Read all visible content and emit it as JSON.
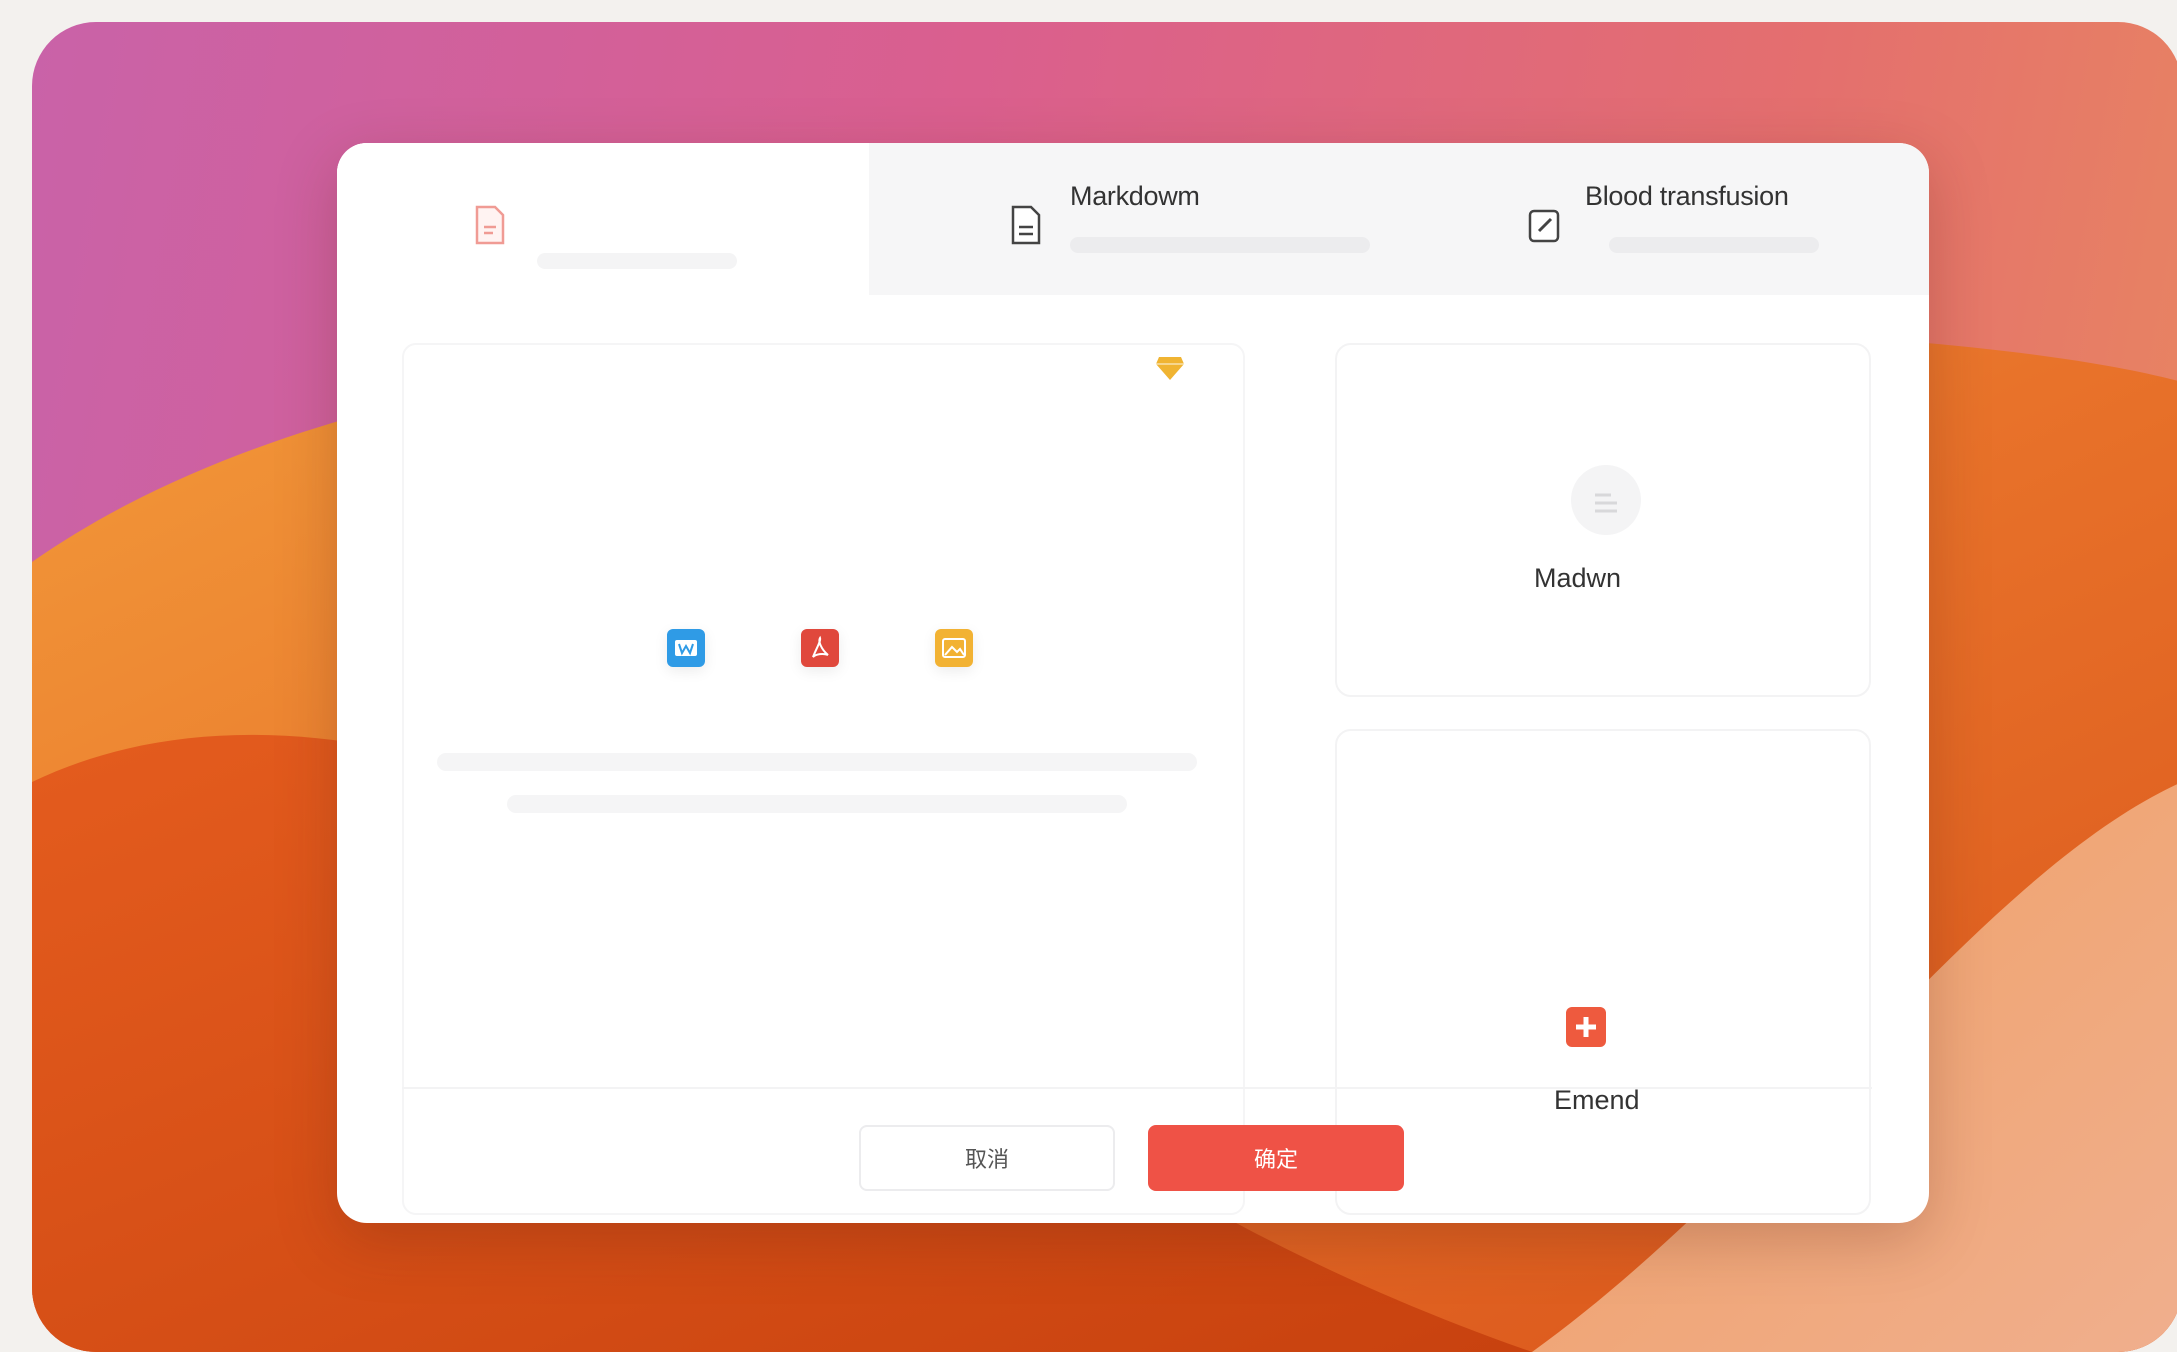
{
  "tabs": [
    {
      "label": "",
      "icon": "document-icon",
      "active": true
    },
    {
      "label": "Markdowm",
      "icon": "document-icon",
      "active": false
    },
    {
      "label": "Blood transfusion",
      "icon": "edit-icon",
      "active": false
    }
  ],
  "upload_panel": {
    "premium_icon": "gem-icon",
    "file_types": [
      {
        "icon": "word-file-icon",
        "color": "#2f9be6"
      },
      {
        "icon": "pdf-file-icon",
        "color": "#e0483c"
      },
      {
        "icon": "image-file-icon",
        "color": "#f2b233"
      }
    ]
  },
  "cards": [
    {
      "label": "Madwn",
      "icon": "markdown-file-icon"
    },
    {
      "label": "Emend",
      "icon": "plus-square-icon",
      "color": "#ee5a3e"
    }
  ],
  "footer": {
    "cancel_label": "取消",
    "confirm_label": "确定"
  },
  "colors": {
    "accent": "#ef5246"
  }
}
